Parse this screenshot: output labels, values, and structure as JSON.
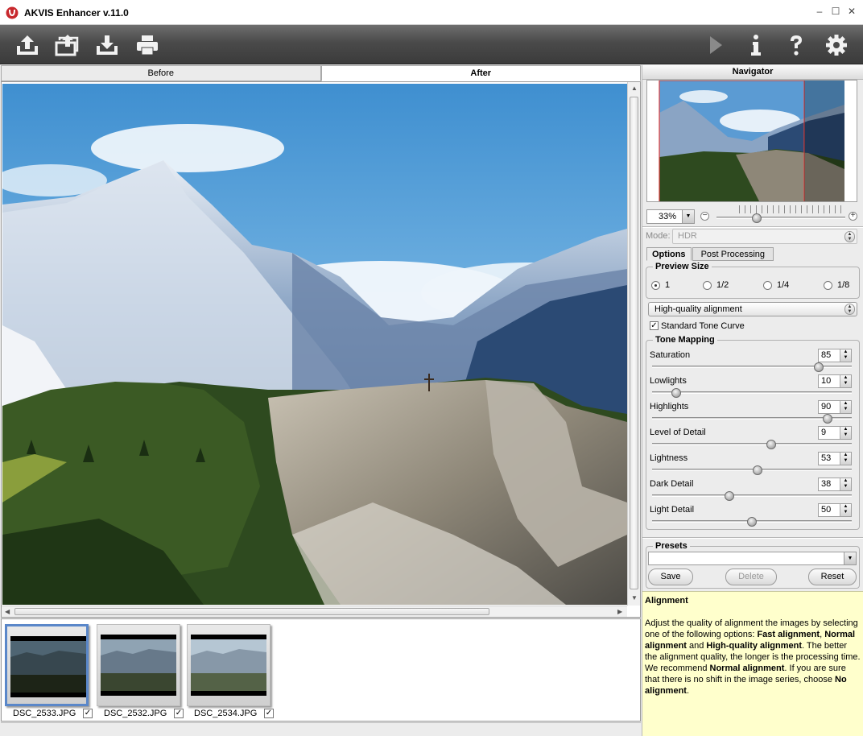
{
  "window": {
    "title": "AKVIS Enhancer v.11.0",
    "min": "–",
    "max": "☐",
    "close": "✕"
  },
  "view_tabs": {
    "before": "Before",
    "after": "After"
  },
  "filmstrip": [
    {
      "name": "DSC_2533.JPG",
      "checked": "✓"
    },
    {
      "name": "DSC_2532.JPG",
      "checked": "✓"
    },
    {
      "name": "DSC_2534.JPG",
      "checked": "✓"
    }
  ],
  "navigator": {
    "title": "Navigator",
    "zoom": "33%"
  },
  "mode": {
    "label": "Mode:",
    "value": "HDR"
  },
  "settings_tabs": {
    "options": "Options",
    "post": "Post Processing"
  },
  "preview_size": {
    "title": "Preview Size",
    "options": [
      "1",
      "1/2",
      "1/4",
      "1/8"
    ],
    "selected": "1"
  },
  "alignment": {
    "value": "High-quality alignment"
  },
  "tone_curve": {
    "label": "Standard Tone Curve",
    "checked": "✓"
  },
  "tone_mapping": {
    "title": "Tone Mapping",
    "params": [
      {
        "label": "Saturation",
        "value": "85",
        "fraction": 0.85
      },
      {
        "label": "Lowlights",
        "value": "10",
        "fraction": 0.1
      },
      {
        "label": "Highlights",
        "value": "90",
        "fraction": 0.9
      },
      {
        "label": "Level of Detail",
        "value": "9",
        "fraction": 0.6
      },
      {
        "label": "Lightness",
        "value": "53",
        "fraction": 0.53
      },
      {
        "label": "Dark Detail",
        "value": "38",
        "fraction": 0.38
      },
      {
        "label": "Light Detail",
        "value": "50",
        "fraction": 0.5
      }
    ]
  },
  "presets": {
    "title": "Presets",
    "save": "Save",
    "delete": "Delete",
    "reset": "Reset"
  },
  "help": {
    "title": "Alignment",
    "t1": "Adjust the quality of alignment the images by selecting one of the following options: ",
    "b1": "Fast alignment",
    "t2": ", ",
    "b2": "Normal alignment",
    "t3": " and ",
    "b3": "High-quality alignment",
    "t4": ". The better the alignment quality, the longer is the processing time. We recommend ",
    "b4": "Normal alignment",
    "t5": ". If you are sure that there is no shift in the image series, choose ",
    "b5": "No alignment",
    "t6": "."
  }
}
